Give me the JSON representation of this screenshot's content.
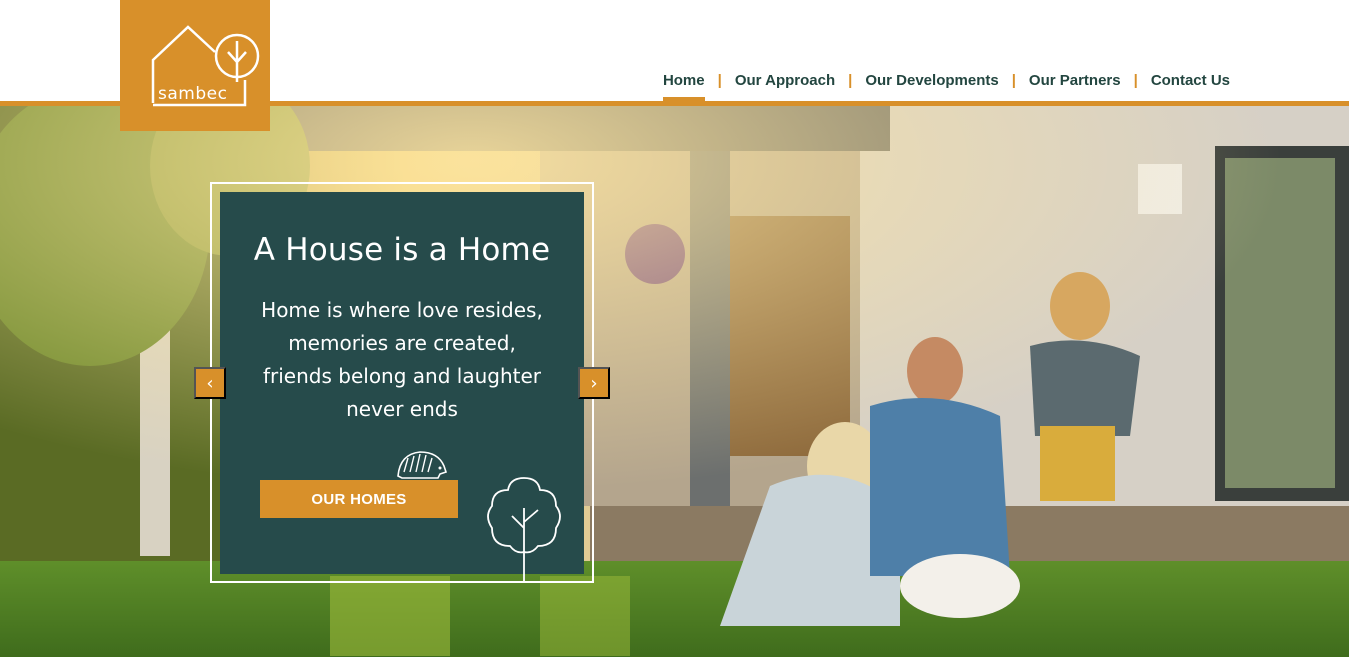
{
  "brand": {
    "name": "sambec",
    "color": "#d8902a",
    "dark": "#264b4b"
  },
  "nav": {
    "items": [
      {
        "label": "Home",
        "active": true
      },
      {
        "label": "Our Approach"
      },
      {
        "label": "Our Developments"
      },
      {
        "label": "Our Partners"
      },
      {
        "label": "Contact Us"
      }
    ],
    "separator": "|"
  },
  "hero": {
    "title": "A House is a Home",
    "body_lines": [
      "Home is where love resides,",
      "memories are created,",
      "friends belong and laughter",
      "never ends"
    ],
    "cta_label": "OUR HOMES",
    "prev_icon": "chevron-left-icon",
    "next_icon": "chevron-right-icon",
    "prev_glyph": "‹",
    "next_glyph": "›"
  }
}
